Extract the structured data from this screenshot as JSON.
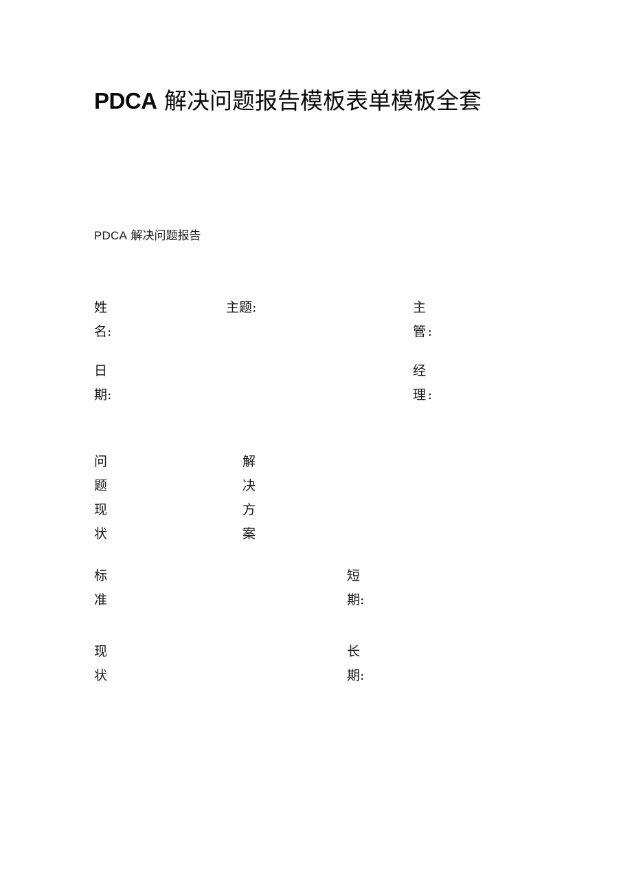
{
  "document": {
    "title": {
      "latin": "PDCA",
      "chinese": "解决问题报告模板表单模板全套",
      "full": "PDCA 解决问题报告模板表单模板全套"
    },
    "subtitle": {
      "latin": "PDCA",
      "chinese": "解决问题报告",
      "full": "PDCA 解决问题报告"
    },
    "background_color": "#ffffff",
    "text_color": "#000000"
  },
  "form": {
    "rows": [
      {
        "col1": "姓名:",
        "col2": "主题:",
        "col3": "主管:"
      },
      {
        "col1": "日期:",
        "col2": "",
        "col3": "经理:"
      },
      {
        "col1": "问题现状",
        "col2": "解决方案",
        "col3": ""
      },
      {
        "col1": "标准",
        "col2": "短期:",
        "col3": ""
      },
      {
        "col1": "现状",
        "col2": "长期:",
        "col3": ""
      }
    ]
  }
}
